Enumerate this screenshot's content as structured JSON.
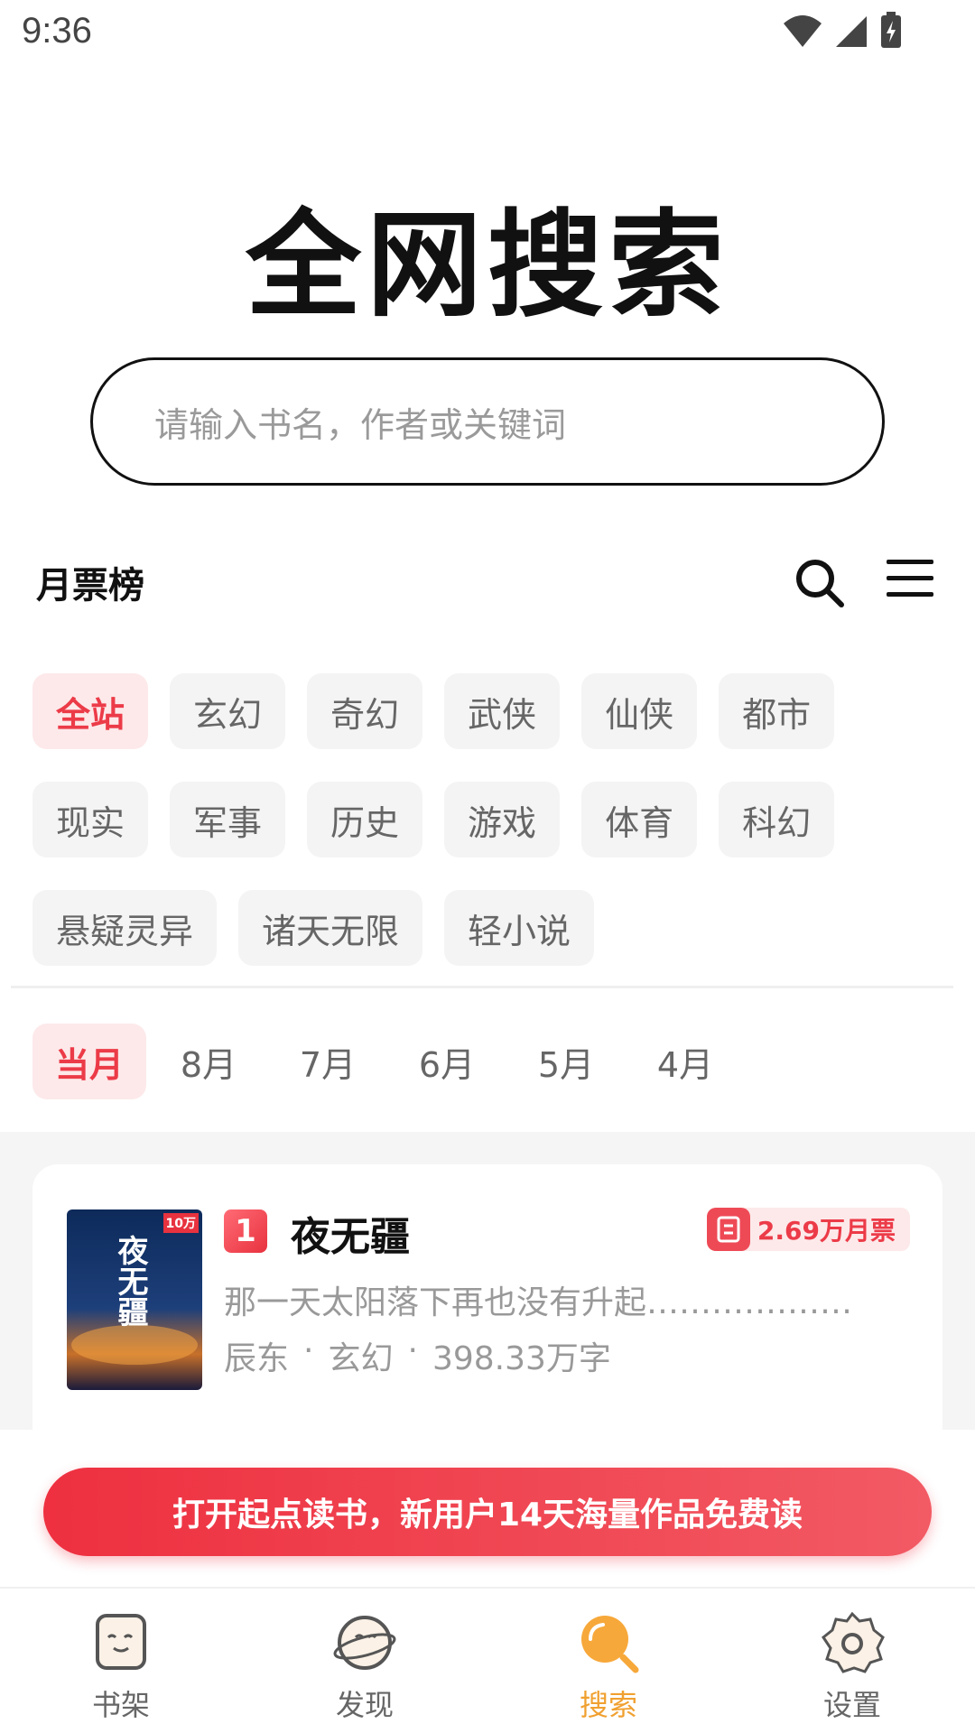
{
  "status_bar": {
    "time": "9:36"
  },
  "hero": {
    "title": "全网搜索"
  },
  "search": {
    "placeholder": "请输入书名，作者或关键词"
  },
  "ranking": {
    "title": "月票榜"
  },
  "categories": {
    "row1": [
      "全站",
      "玄幻",
      "奇幻",
      "武侠",
      "仙侠",
      "都市"
    ],
    "row2": [
      "现实",
      "军事",
      "历史",
      "游戏",
      "体育",
      "科幻"
    ],
    "row3": [
      "悬疑灵异",
      "诸天无限",
      "轻小说"
    ],
    "active": "全站"
  },
  "months": {
    "items": [
      "当月",
      "8月",
      "7月",
      "6月",
      "5月",
      "4月"
    ],
    "active": "当月"
  },
  "book": {
    "rank": "1",
    "title": "夜无疆",
    "tickets": "2.69万月票",
    "description": "那一天太阳落下再也没有升起…………………",
    "author": "辰东",
    "genre": "玄幻",
    "words": "398.33万字",
    "cover_text": "夜无疆",
    "cover_badge": "10万"
  },
  "promo": {
    "label": "打开起点读书，新用户14天海量作品免费读"
  },
  "bottom_nav": {
    "items": [
      {
        "label": "书架",
        "icon": "bookshelf-icon"
      },
      {
        "label": "发现",
        "icon": "discover-icon"
      },
      {
        "label": "搜索",
        "icon": "search-icon"
      },
      {
        "label": "设置",
        "icon": "settings-icon"
      }
    ],
    "active": "搜索"
  },
  "colors": {
    "accent": "#ec3b48",
    "active_tab": "#f0a030",
    "chip_bg": "#f4f4f4"
  }
}
